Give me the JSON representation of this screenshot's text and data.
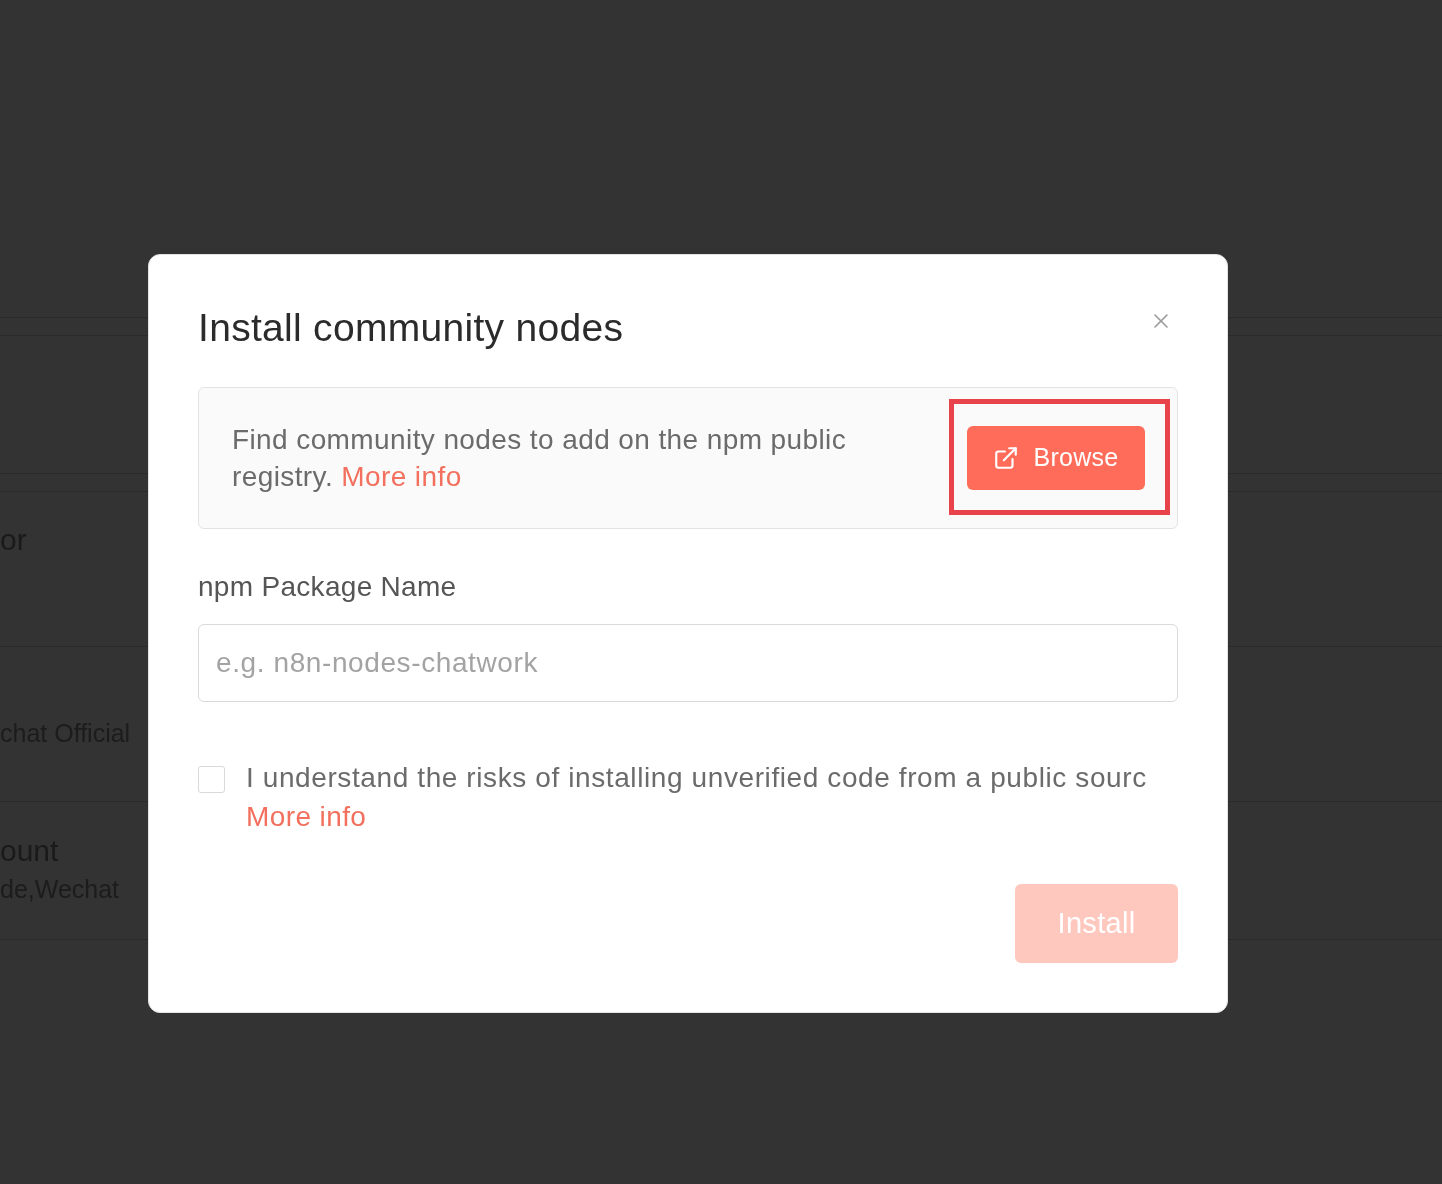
{
  "background": {
    "rows": [
      {
        "title": "or"
      },
      {
        "subtitle": "chat Official"
      },
      {
        "title": "ount",
        "subtitle": "de,Wechat"
      }
    ]
  },
  "dialog": {
    "title": "Install community nodes",
    "info": {
      "text": "Find community nodes to add on the npm public registry.",
      "link": "More info",
      "button": {
        "label": "Browse",
        "highlighted": true
      }
    },
    "package_field": {
      "label": "npm Package Name",
      "placeholder": "e.g. n8n-nodes-chatwork"
    },
    "consent": {
      "checked": false,
      "text": "I understand the risks of installing unverified code from a public sourc",
      "link": "More info"
    },
    "install_button": {
      "label": "Install",
      "disabled": true
    }
  }
}
